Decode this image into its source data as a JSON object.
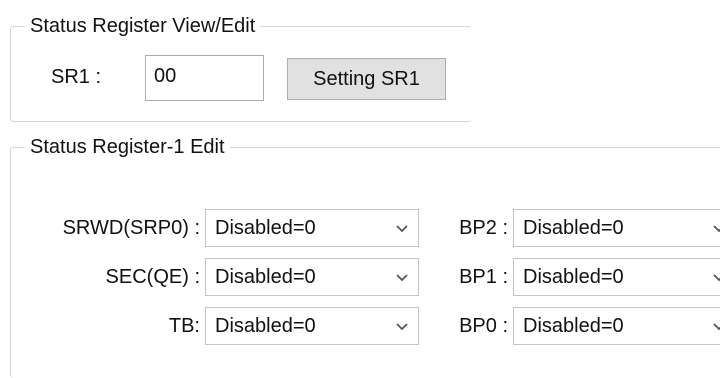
{
  "status_view": {
    "title": "Status Register View/Edit",
    "sr1_label": "SR1 :",
    "sr1_value": "00",
    "setting_button": "Setting SR1"
  },
  "sr1_edit": {
    "title": "Status Register-1 Edit",
    "rows": [
      {
        "left_label": "SRWD(SRP0) :",
        "left_value": "Disabled=0",
        "right_label": "BP2 :",
        "right_value": "Disabled=0"
      },
      {
        "left_label": "SEC(QE) :",
        "left_value": "Disabled=0",
        "right_label": "BP1 :",
        "right_value": "Disabled=0"
      },
      {
        "left_label": "TB:",
        "left_value": "Disabled=0",
        "right_label": "BP0 :",
        "right_value": "Disabled=0"
      }
    ]
  },
  "icons": {
    "dropdown": "chevron-down-icon"
  },
  "colors": {
    "border": "#d5d5d5",
    "button_bg": "#e1e1e1",
    "chevron": "#555555"
  }
}
